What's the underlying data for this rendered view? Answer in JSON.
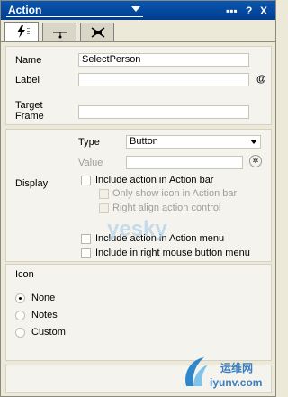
{
  "titlebar": {
    "title": "Action",
    "buttons": [
      "▪▪▪",
      "?",
      "X"
    ]
  },
  "tabs": [
    {
      "icon": "lightning-icon",
      "active": true
    },
    {
      "icon": "transition-icon",
      "active": false
    },
    {
      "icon": "event-icon",
      "active": false
    }
  ],
  "general": {
    "name_label": "Name",
    "name_value": "SelectPerson",
    "label_label": "Label",
    "label_value": "",
    "label_at": "@",
    "target_label": "Target Frame",
    "target_value": ""
  },
  "display": {
    "section_label": "Display",
    "type_label": "Type",
    "type_value": "Button",
    "value_label": "Value",
    "value_value": "",
    "checkboxes": [
      {
        "label": "Include action in Action bar",
        "enabled": true
      },
      {
        "label": "Only show icon in Action bar",
        "enabled": false
      },
      {
        "label": "Right align action control",
        "enabled": false
      },
      {
        "label": "Include action in Action menu",
        "enabled": true
      },
      {
        "label": "Include in right mouse button menu",
        "enabled": true
      }
    ]
  },
  "icon": {
    "section_label": "Icon",
    "options": [
      {
        "label": "None",
        "selected": true
      },
      {
        "label": "Notes",
        "selected": false
      },
      {
        "label": "Custom",
        "selected": false
      }
    ]
  },
  "watermark": {
    "top": "yesky",
    "bottom_cn": "运维网",
    "bottom_url": "iyunv.com"
  }
}
